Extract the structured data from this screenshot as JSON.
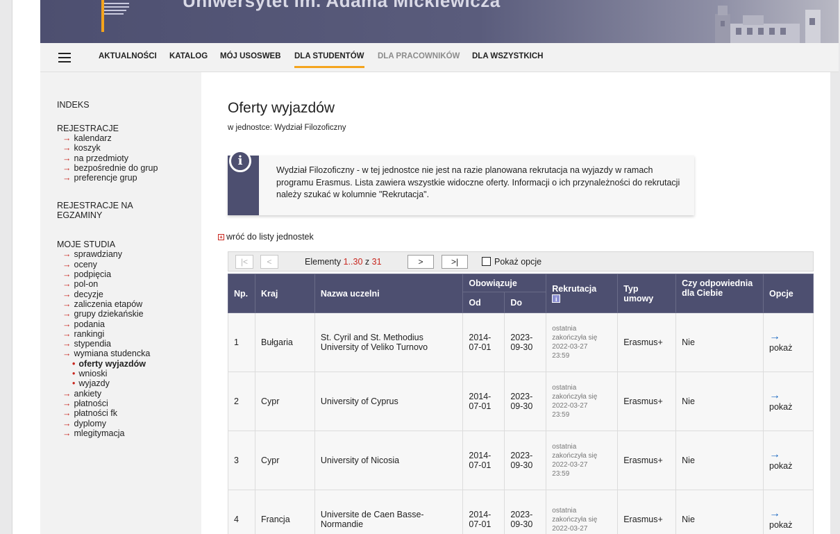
{
  "banner": {
    "title": "Uniwersytet im. Adama Mickiewicza"
  },
  "nav": {
    "items": [
      {
        "label": "AKTUALNOŚCI"
      },
      {
        "label": "KATALOG"
      },
      {
        "label": "MÓJ USOSWEB"
      },
      {
        "label": "DLA STUDENTÓW"
      },
      {
        "label": "DLA PRACOWNIKÓW"
      },
      {
        "label": "DLA WSZYSTKICH"
      }
    ],
    "active": "DLA STUDENTÓW"
  },
  "sidebar": {
    "indeks": "INDEKS",
    "rejestracje": "REJESTRACJE",
    "rejestracje_items": [
      "kalendarz",
      "koszyk",
      "na przedmioty",
      "bezpośrednie do grup",
      "preferencje grup"
    ],
    "rejestracje_egz_1": "REJESTRACJE NA",
    "rejestracje_egz_2": "EGZAMINY",
    "moje_studia": "MOJE STUDIA",
    "studia_items": [
      "sprawdziany",
      "oceny",
      "podpięcia",
      "pol-on",
      "decyzje",
      "zaliczenia etapów",
      "grupy dziekańskie",
      "podania",
      "rankingi",
      "stypendia",
      "wymiana studencka"
    ],
    "wymiana_sub": [
      "oferty wyjazdów",
      "wnioski",
      "wyjazdy"
    ],
    "more_items": [
      "ankiety",
      "płatności",
      "płatności fk",
      "dyplomy",
      "mlegitymacja"
    ]
  },
  "main": {
    "title": "Oferty wyjazdów",
    "unit_line": "w jednostce: Wydział Filozoficzny",
    "info_icon": "i",
    "info_text": "Wydział Filozoficzny - w tej jednostce nie jest na razie planowana rekrutacja na wyjazdy w ramach programu Erasmus. Lista zawiera wszystkie widoczne oferty. Informacji o ich przynależności do rekrutacji należy szukać w kolumnie \"Rekrutacja\".",
    "back_link": "wróć do listy jednostek"
  },
  "pager": {
    "first": "|<",
    "prev": "<",
    "next": ">",
    "last": ">|",
    "label": "Elementy",
    "range": "1..30",
    "of": "z",
    "total": "31",
    "show_options": "Pokaż opcje"
  },
  "table": {
    "headers": {
      "np": "Np.",
      "kraj": "Kraj",
      "nazwa": "Nazwa uczelni",
      "obowiazuje": "Obowiązuje",
      "od": "Od",
      "do": "Do",
      "rekrutacja": "Rekrutacja",
      "rek_info": "i",
      "typ_1": "Typ",
      "typ_2": "umowy",
      "czy_1": "Czy odpowiednia",
      "czy_2": "dla Ciebie",
      "opcje": "Opcje"
    },
    "rows": [
      {
        "np": "1",
        "kraj": "Bułgaria",
        "nazwa_1": "St. Cyril and St. Methodius",
        "nazwa_2": "University of Veliko Turnovo",
        "od_1": "2014-",
        "od_2": "07-01",
        "do_1": "2023-",
        "do_2": "09-30",
        "rek_1": "ostatnia",
        "rek_2": "zakończyła się",
        "rek_3": "2022-03-27",
        "rek_4": "23:59",
        "typ": "Erasmus+",
        "czy": "Nie",
        "arrow": "→",
        "opcja": "pokaż"
      },
      {
        "np": "2",
        "kraj": "Cypr",
        "nazwa_1": "University of Cyprus",
        "nazwa_2": "",
        "od_1": "2014-",
        "od_2": "07-01",
        "do_1": "2023-",
        "do_2": "09-30",
        "rek_1": "ostatnia",
        "rek_2": "zakończyła się",
        "rek_3": "2022-03-27",
        "rek_4": "23:59",
        "typ": "Erasmus+",
        "czy": "Nie",
        "arrow": "→",
        "opcja": "pokaż"
      },
      {
        "np": "3",
        "kraj": "Cypr",
        "nazwa_1": "University of Nicosia",
        "nazwa_2": "",
        "od_1": "2014-",
        "od_2": "07-01",
        "do_1": "2023-",
        "do_2": "09-30",
        "rek_1": "ostatnia",
        "rek_2": "zakończyła się",
        "rek_3": "2022-03-27",
        "rek_4": "23:59",
        "typ": "Erasmus+",
        "czy": "Nie",
        "arrow": "→",
        "opcja": "pokaż"
      },
      {
        "np": "4",
        "kraj": "Francja",
        "nazwa_1": "Universite de Caen Basse-",
        "nazwa_2": "Normandie",
        "od_1": "2014-",
        "od_2": "07-01",
        "do_1": "2023-",
        "do_2": "09-30",
        "rek_1": "ostatnia",
        "rek_2": "zakończyła się",
        "rek_3": "2022-03-27",
        "rek_4": "",
        "typ": "Erasmus+",
        "czy": "Nie",
        "arrow": "→",
        "opcja": "pokaż"
      }
    ]
  }
}
